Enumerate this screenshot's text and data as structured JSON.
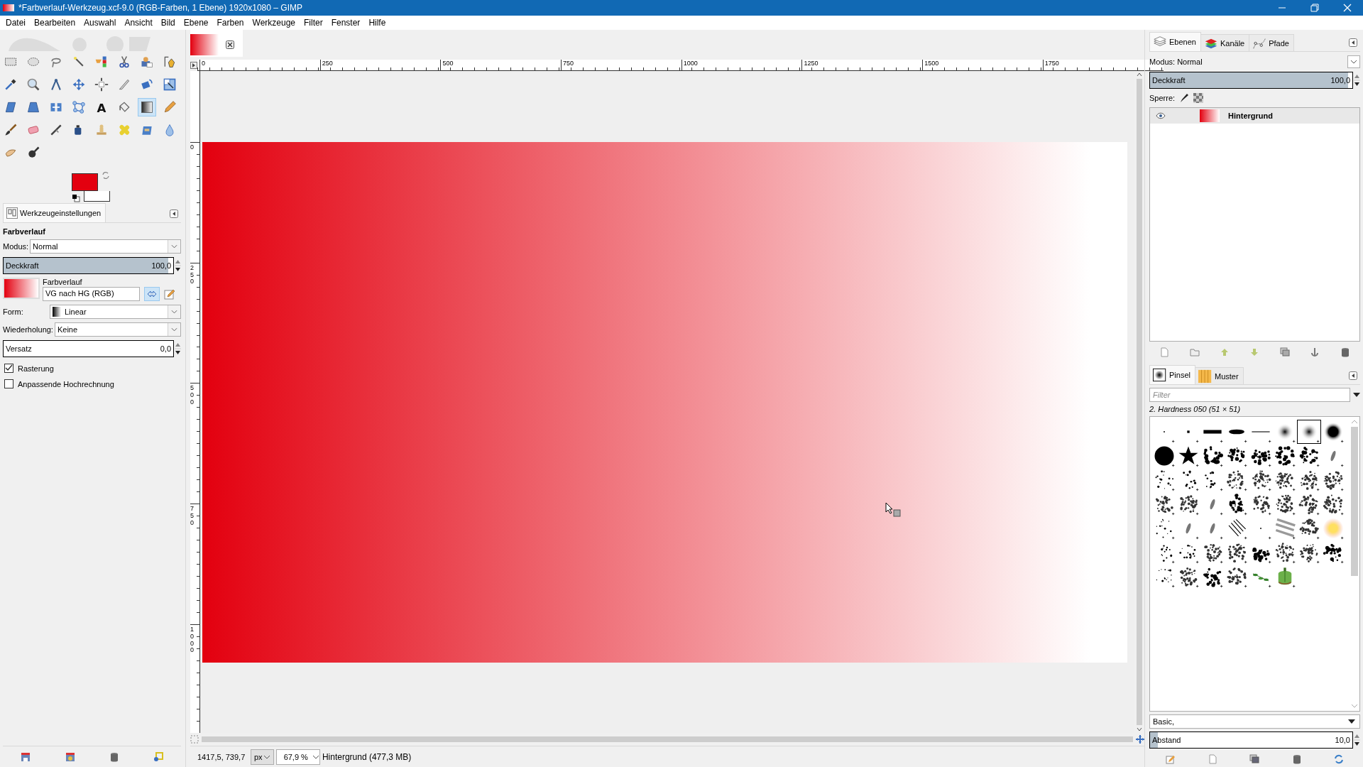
{
  "window": {
    "title": "*Farbverlauf-Werkzeug.xcf-9.0 (RGB-Farben, 1 Ebene) 1920x1080 – GIMP"
  },
  "menu": [
    "Datei",
    "Bearbeiten",
    "Auswahl",
    "Ansicht",
    "Bild",
    "Ebene",
    "Farben",
    "Werkzeuge",
    "Filter",
    "Fenster",
    "Hilfe"
  ],
  "toolbox": {
    "colors": [
      {
        "kind": "foreground",
        "color": "#e3000f"
      },
      {
        "kind": "background",
        "color": "#ffffff"
      }
    ],
    "tools": [
      {
        "kind": "rect-select",
        "selected": false
      },
      {
        "kind": "ellipse-select",
        "selected": false
      },
      {
        "kind": "lasso",
        "selected": false
      },
      {
        "kind": "wand",
        "selected": false
      },
      {
        "kind": "color-select",
        "selected": false
      },
      {
        "kind": "scissors",
        "selected": false
      },
      {
        "kind": "foreground-select",
        "selected": false
      },
      {
        "kind": "paths",
        "selected": false
      },
      {
        "kind": "color-picker",
        "selected": false
      },
      {
        "kind": "zoom",
        "selected": false
      },
      {
        "kind": "measure",
        "selected": false
      },
      {
        "kind": "move",
        "selected": false
      },
      {
        "kind": "align",
        "selected": false
      },
      {
        "kind": "crop",
        "selected": false
      },
      {
        "kind": "unified",
        "selected": false
      },
      {
        "kind": "scale",
        "selected": false
      },
      {
        "kind": "shear",
        "selected": false
      },
      {
        "kind": "perspective",
        "selected": false
      },
      {
        "kind": "flip",
        "selected": false
      },
      {
        "kind": "handle",
        "selected": false
      },
      {
        "kind": "text",
        "glyph": "A",
        "selected": false
      },
      {
        "kind": "bucket",
        "selected": false
      },
      {
        "kind": "gradient",
        "selected": true
      },
      {
        "kind": "pencil",
        "selected": false
      },
      {
        "kind": "paintbrush",
        "selected": false
      },
      {
        "kind": "eraser",
        "selected": false
      },
      {
        "kind": "airbrush",
        "selected": false
      },
      {
        "kind": "ink",
        "selected": false
      },
      {
        "kind": "clone",
        "selected": false
      },
      {
        "kind": "heal",
        "selected": false
      },
      {
        "kind": "perspective-clone",
        "selected": false
      },
      {
        "kind": "blur",
        "selected": false
      },
      {
        "kind": "smudge",
        "selected": false
      },
      {
        "kind": "dodge",
        "selected": false
      }
    ]
  },
  "tool_options": {
    "tab": "Werkzeugeinstellungen",
    "heading": "Farbverlauf",
    "mode_label": "Modus:",
    "mode": "Normal",
    "opacity": {
      "label": "Deckkraft",
      "value": "100,0",
      "level": 0.97
    },
    "gradient_label": "Farbverlauf",
    "gradient": "VG nach HG (RGB)",
    "shape_label": "Form:",
    "shape": "Linear",
    "repeat_label": "Wiederholung:",
    "repeat": "Keine",
    "offset": {
      "label": "Versatz",
      "value": "0,0"
    },
    "checkboxes": [
      {
        "label": "Rasterung",
        "checked": true
      },
      {
        "label": "Anpassende Hochrechnung",
        "checked": false
      }
    ]
  },
  "rulers": {
    "horizontal": [
      "0",
      "250",
      "500",
      "750",
      "1000",
      "1250",
      "1500",
      "1750"
    ],
    "vertical": [
      "0",
      "250",
      "500",
      "750",
      "1000"
    ]
  },
  "status_bar": {
    "coordinates": "1417,5, 739,7",
    "unit": "px",
    "zoom": "67,9 %",
    "info": "Hintergrund (477,3 MB)"
  },
  "layers_dock": {
    "tabs": [
      {
        "label": "Ebenen",
        "kind": "layers",
        "selected": true
      },
      {
        "label": "Kanäle",
        "kind": "channels",
        "selected": false
      },
      {
        "label": "Pfade",
        "kind": "paths",
        "selected": false
      }
    ],
    "mode": "Modus: Normal",
    "opacity": {
      "label": "Deckkraft",
      "value": "100,0",
      "level": 0.98
    },
    "lock_label": "Sperre:",
    "layers": [
      {
        "name": "Hintergrund",
        "visible": true,
        "selected": true
      }
    ]
  },
  "brushes_dock": {
    "tabs": [
      {
        "label": "Pinsel",
        "kind": "brushes",
        "selected": true
      },
      {
        "label": "Muster",
        "kind": "patterns",
        "selected": false
      }
    ],
    "filter_placeholder": "Filter",
    "current": "2. Hardness 050 (51 × 51)",
    "brushes": [
      {
        "kind": "pixel",
        "selected": false
      },
      {
        "kind": "dot",
        "selected": false
      },
      {
        "kind": "bar",
        "selected": false
      },
      {
        "kind": "ellipse",
        "selected": false
      },
      {
        "kind": "line",
        "selected": false
      },
      {
        "kind": "soft",
        "selected": false
      },
      {
        "kind": "soft",
        "selected": true
      },
      {
        "kind": "hard",
        "selected": false
      },
      {
        "kind": "disc",
        "selected": false
      },
      {
        "kind": "star",
        "selected": false
      },
      {
        "kind": "splatter",
        "selected": false
      },
      {
        "kind": "splatter",
        "selected": false
      },
      {
        "kind": "splatter",
        "selected": false
      },
      {
        "kind": "splatter",
        "selected": false
      },
      {
        "kind": "splatter",
        "selected": false
      },
      {
        "kind": "streak",
        "selected": false
      },
      {
        "kind": "scatter",
        "selected": false
      },
      {
        "kind": "scatter",
        "selected": false
      },
      {
        "kind": "scatter",
        "selected": false
      },
      {
        "kind": "texture",
        "selected": false
      },
      {
        "kind": "texture",
        "selected": false
      },
      {
        "kind": "texture",
        "selected": false
      },
      {
        "kind": "texture",
        "selected": false
      },
      {
        "kind": "texture",
        "selected": false
      },
      {
        "kind": "texture",
        "selected": false
      },
      {
        "kind": "texture",
        "selected": false
      },
      {
        "kind": "streak",
        "selected": false
      },
      {
        "kind": "splatter",
        "selected": false
      },
      {
        "kind": "texture",
        "selected": false
      },
      {
        "kind": "texture",
        "selected": false
      },
      {
        "kind": "texture",
        "selected": false
      },
      {
        "kind": "texture",
        "selected": false
      },
      {
        "kind": "scatter",
        "selected": false
      },
      {
        "kind": "streak",
        "selected": false
      },
      {
        "kind": "streak",
        "selected": false
      },
      {
        "kind": "lines",
        "selected": false
      },
      {
        "kind": "pixel",
        "selected": false
      },
      {
        "kind": "stripes",
        "selected": false
      },
      {
        "kind": "texture",
        "selected": false
      },
      {
        "kind": "sun",
        "selected": false
      },
      {
        "kind": "scatter",
        "selected": false
      },
      {
        "kind": "scatter",
        "selected": false
      },
      {
        "kind": "texture",
        "selected": false
      },
      {
        "kind": "texture",
        "selected": false
      },
      {
        "kind": "splatter",
        "selected": false
      },
      {
        "kind": "texture",
        "selected": false
      },
      {
        "kind": "texture",
        "selected": false
      },
      {
        "kind": "splatter",
        "selected": false
      },
      {
        "kind": "scatter",
        "selected": false
      },
      {
        "kind": "texture",
        "selected": false
      },
      {
        "kind": "splatter",
        "selected": false
      },
      {
        "kind": "texture",
        "selected": false
      },
      {
        "kind": "leaves",
        "selected": false
      },
      {
        "kind": "pepper",
        "selected": false
      }
    ],
    "tag": "Basic,",
    "spacing": {
      "label": "Abstand",
      "value": "10,0",
      "level": 0.04
    }
  }
}
